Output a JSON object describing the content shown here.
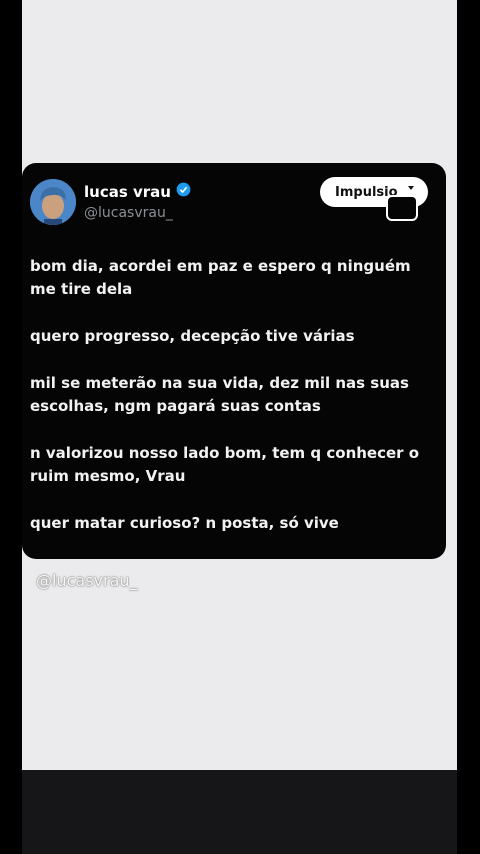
{
  "post": {
    "name": "lucas vrau",
    "handle": "@lucasvrau_",
    "button_label": "Impulsio",
    "paragraphs": [
      "bom dia, acordei em paz e espero q ninguém me tire dela",
      "quero progresso, decepção tive várias",
      "mil se meterão na sua vida, dez mil nas suas escolhas, ngm pagará suas contas",
      "n valorizou nosso lado bom, tem q conhecer o ruim mesmo, Vrau",
      "quer matar curioso? n posta, só vive"
    ]
  },
  "watermark": "@lucasvrau_",
  "colors": {
    "background": "#000000",
    "panel": "#ebebed",
    "card": "#050505",
    "verified": "#1d9bf0"
  },
  "icons": [
    "verified-badge-icon",
    "chevron-down-icon"
  ]
}
